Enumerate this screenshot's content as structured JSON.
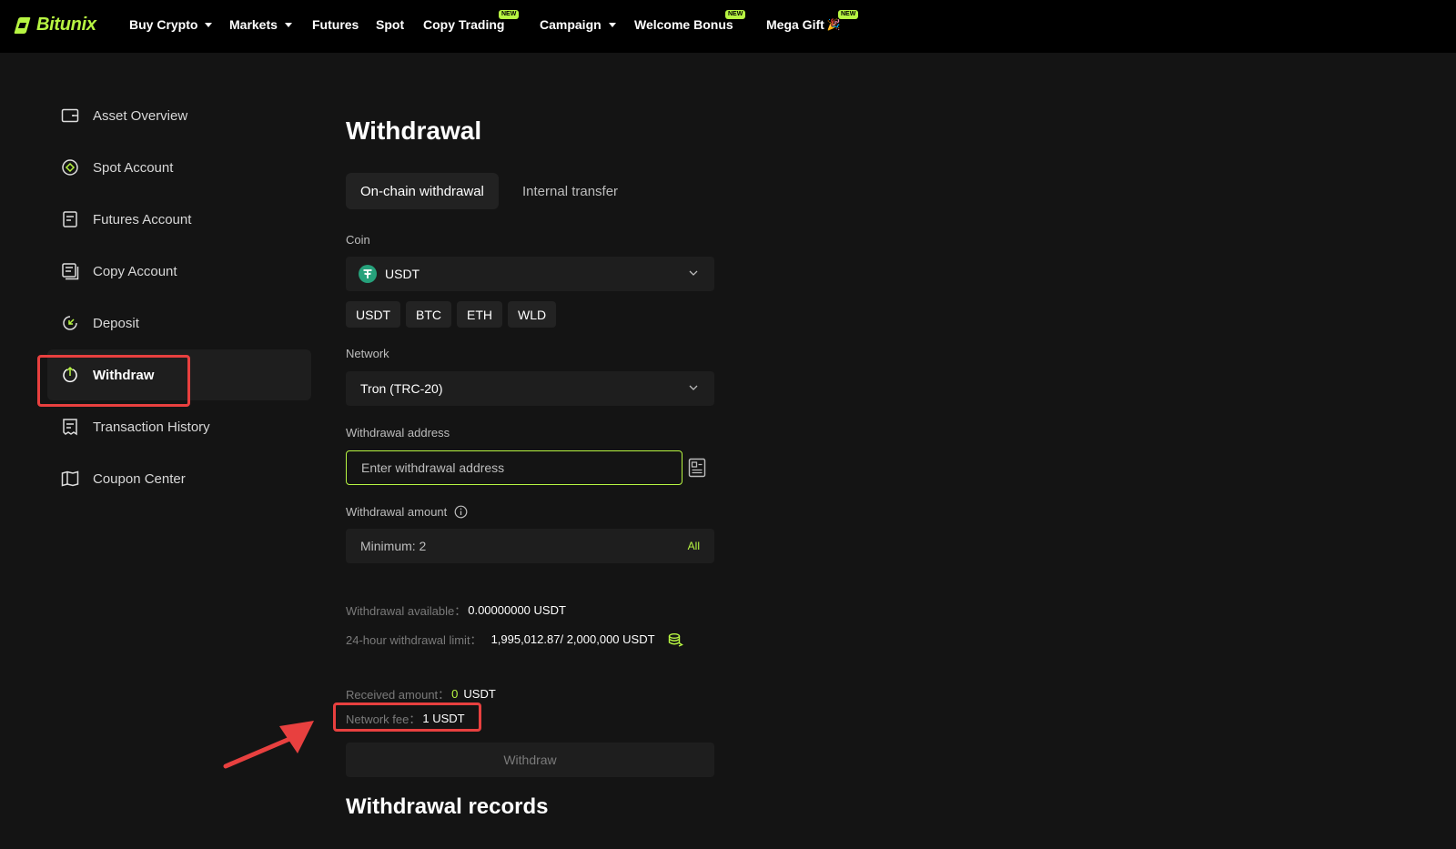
{
  "brand": {
    "name": "Bitunix",
    "color": "#b7f542"
  },
  "nav": {
    "items": [
      {
        "label": "Buy Crypto",
        "dropdown": true
      },
      {
        "label": "Markets",
        "dropdown": true
      },
      {
        "label": "Futures"
      },
      {
        "label": "Spot"
      },
      {
        "label": "Copy Trading",
        "badge": "NEW"
      },
      {
        "label": "Campaign",
        "dropdown": true
      },
      {
        "label": "Welcome Bonus",
        "badge": "NEW"
      },
      {
        "label": "Mega Gift",
        "badge": "NEW",
        "emoji": "🎉"
      }
    ]
  },
  "sidebar": {
    "items": [
      {
        "label": "Asset Overview",
        "icon": "wallet-icon"
      },
      {
        "label": "Spot Account",
        "icon": "spot-icon"
      },
      {
        "label": "Futures Account",
        "icon": "futures-icon"
      },
      {
        "label": "Copy Account",
        "icon": "copy-icon"
      },
      {
        "label": "Deposit",
        "icon": "deposit-icon"
      },
      {
        "label": "Withdraw",
        "icon": "withdraw-icon",
        "active": true
      },
      {
        "label": "Transaction History",
        "icon": "receipt-icon"
      },
      {
        "label": "Coupon Center",
        "icon": "coupon-icon"
      }
    ]
  },
  "main": {
    "title": "Withdrawal",
    "tabs": [
      {
        "label": "On-chain withdrawal",
        "active": true
      },
      {
        "label": "Internal transfer"
      }
    ],
    "coin": {
      "label": "Coin",
      "selected": "USDT",
      "quick": [
        "USDT",
        "BTC",
        "ETH",
        "WLD"
      ]
    },
    "network": {
      "label": "Network",
      "selected": "Tron (TRC-20)"
    },
    "address": {
      "label": "Withdrawal address",
      "placeholder": "Enter withdrawal address"
    },
    "amount": {
      "label": "Withdrawal amount",
      "placeholder": "Minimum: 2",
      "all_label": "All"
    },
    "available": {
      "label": "Withdrawal available：",
      "value": "0.00000000 USDT"
    },
    "limit": {
      "label": "24-hour withdrawal limit：",
      "value": "1,995,012.87/ 2,000,000 USDT"
    },
    "received": {
      "label": "Received amount：",
      "value": "0",
      "unit": "USDT"
    },
    "fee": {
      "label": "Network fee：",
      "value": "1 USDT"
    },
    "withdraw_button": "Withdraw",
    "records_title": "Withdrawal records"
  },
  "colors": {
    "accent": "#b7f542",
    "highlight": "#e8403f",
    "background": "#141414"
  }
}
